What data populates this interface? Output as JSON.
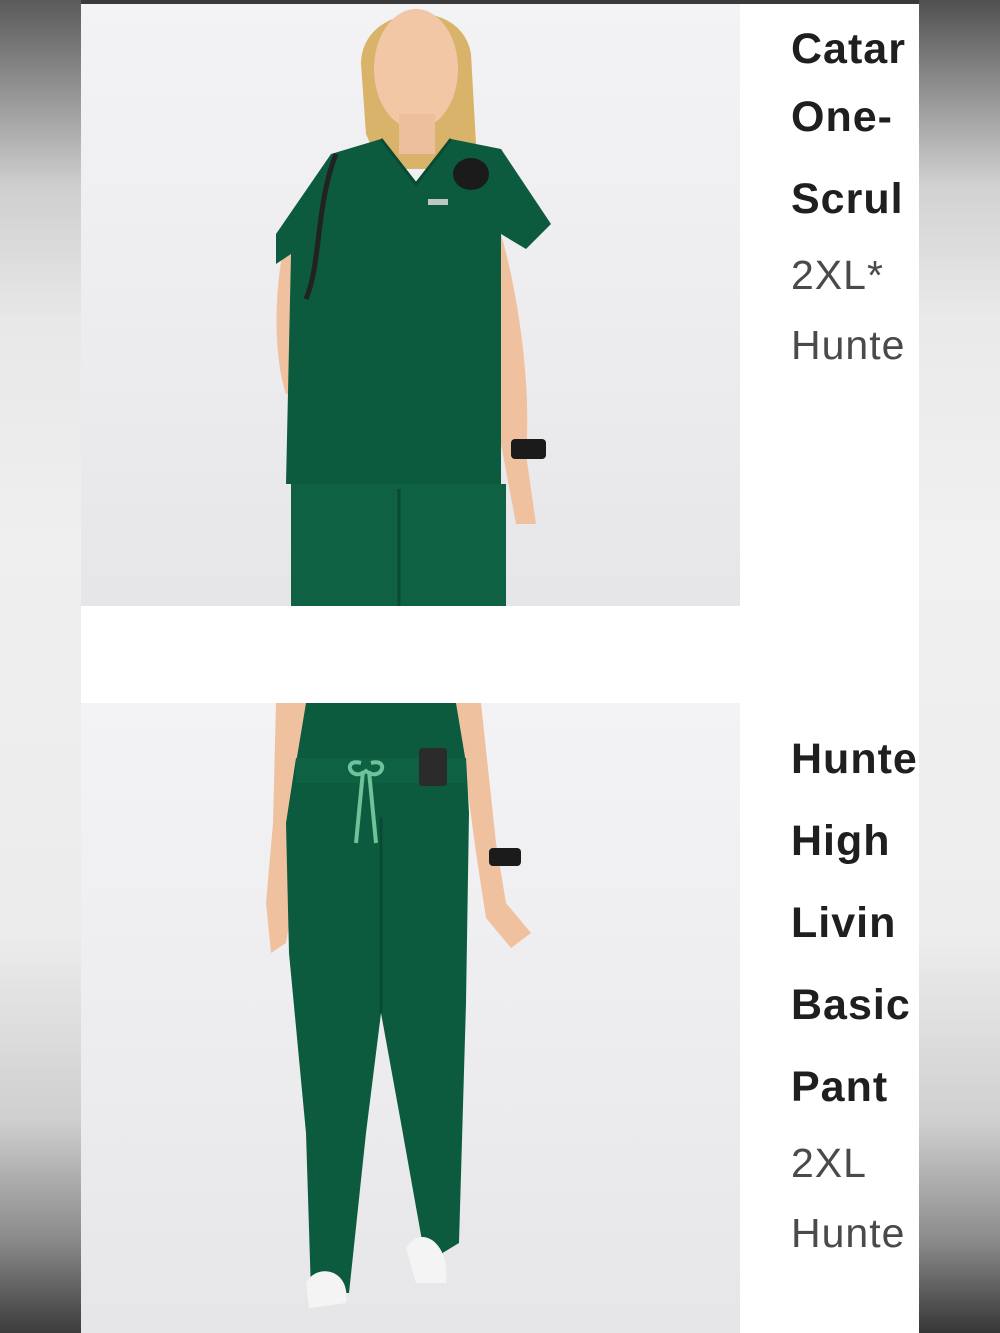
{
  "products": [
    {
      "image_alt": "Woman wearing hunter green scrub top",
      "title_lines": [
        "Catar",
        "One-",
        "Scrul"
      ],
      "size": "2XL*",
      "color": "Hunte"
    },
    {
      "image_alt": "Woman wearing hunter green jogger scrub pants",
      "title_lines": [
        "Hunte",
        "High",
        "Livin",
        "Basic",
        "Pant"
      ],
      "size": "2XL",
      "color": "Hunte"
    }
  ],
  "colors": {
    "scrub_green": "#0c5b3e",
    "drawstring": "#6fc29a",
    "text_dark": "#1f1f1f",
    "text_meta": "#4a4a4a"
  }
}
